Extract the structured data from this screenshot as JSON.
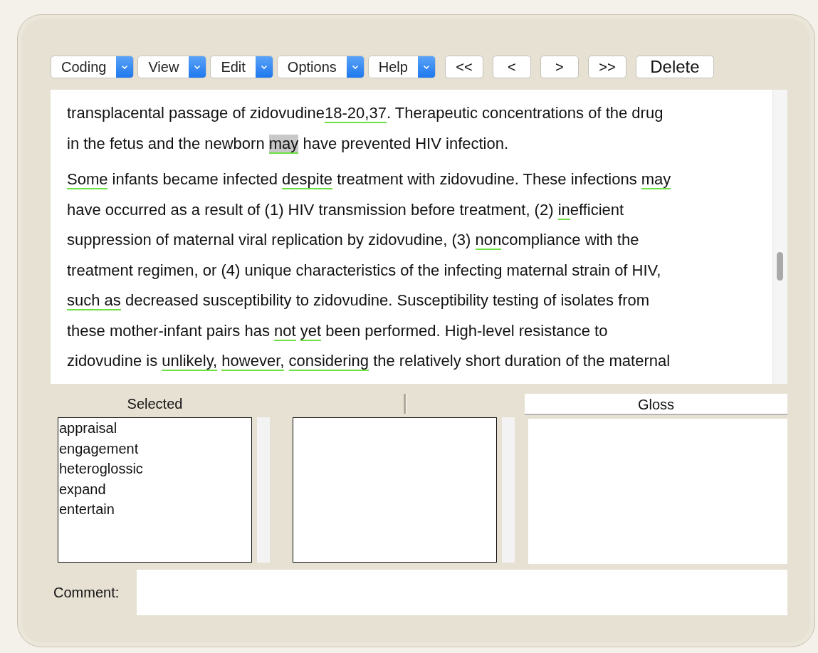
{
  "toolbar": [
    {
      "kind": "menu",
      "label": "Coding"
    },
    {
      "kind": "menu",
      "label": "View"
    },
    {
      "kind": "menu",
      "label": "Edit"
    },
    {
      "kind": "menu",
      "label": "Options"
    },
    {
      "kind": "menu",
      "label": "Help"
    },
    {
      "kind": "button",
      "label": "<<"
    },
    {
      "kind": "button",
      "label": "<"
    },
    {
      "kind": "button",
      "label": ">"
    },
    {
      "kind": "button",
      "label": ">>"
    },
    {
      "kind": "button",
      "label": "Delete"
    }
  ],
  "document": {
    "paragraphs": [
      [
        [
          {
            "text": "transplacental passage of zidovudine",
            "coded": false,
            "highlighted": false
          },
          {
            "text": "18-20,37",
            "coded": true,
            "highlighted": false
          },
          {
            "text": ". Therapeutic concentrations of the drug",
            "coded": false,
            "highlighted": false
          }
        ],
        [
          {
            "text": "in the fetus and the newborn ",
            "coded": false,
            "highlighted": false
          },
          {
            "text": "may",
            "coded": true,
            "highlighted": true
          },
          {
            "text": " have prevented HIV infection.",
            "coded": false,
            "highlighted": false
          }
        ]
      ],
      [
        [
          {
            "text": "Some",
            "coded": true,
            "highlighted": false
          },
          {
            "text": " infants became infected ",
            "coded": false,
            "highlighted": false
          },
          {
            "text": "despite",
            "coded": true,
            "highlighted": false
          },
          {
            "text": " treatment with zidovudine. These infections ",
            "coded": false,
            "highlighted": false
          },
          {
            "text": "may",
            "coded": true,
            "highlighted": false
          }
        ],
        [
          {
            "text": "have occurred as a result of (1) HIV transmission before treatment, (2) ",
            "coded": false,
            "highlighted": false
          },
          {
            "text": "in",
            "coded": true,
            "highlighted": false
          },
          {
            "text": "efficient",
            "coded": false,
            "highlighted": false
          }
        ],
        [
          {
            "text": "suppression of maternal viral replication by zidovudine, (3) ",
            "coded": false,
            "highlighted": false
          },
          {
            "text": "non",
            "coded": true,
            "highlighted": false
          },
          {
            "text": "compliance with the",
            "coded": false,
            "highlighted": false
          }
        ],
        [
          {
            "text": "treatment regimen, or (4) unique characteristics of the infecting maternal strain of HIV,",
            "coded": false,
            "highlighted": false
          }
        ],
        [
          {
            "text": "such as",
            "coded": true,
            "highlighted": false
          },
          {
            "text": " decreased susceptibility to zidovudine. Susceptibility testing of isolates from",
            "coded": false,
            "highlighted": false
          }
        ],
        [
          {
            "text": "these mother-infant pairs has ",
            "coded": false,
            "highlighted": false
          },
          {
            "text": "not",
            "coded": true,
            "highlighted": false
          },
          {
            "text": " yet",
            "coded": true,
            "highlighted": false
          },
          {
            "text": " been performed. High-level resistance to",
            "coded": false,
            "highlighted": false
          }
        ],
        [
          {
            "text": "zidovudine is ",
            "coded": false,
            "highlighted": false
          },
          {
            "text": "un",
            "coded": true,
            "highlighted": false
          },
          {
            "text": "likely,",
            "coded": true,
            "highlighted": false
          },
          {
            "text": " however,",
            "coded": true,
            "highlighted": false
          },
          {
            "text": " considering",
            "coded": true,
            "highlighted": false
          },
          {
            "text": " the relatively short duration of the maternal",
            "coded": false,
            "highlighted": false
          }
        ]
      ]
    ]
  },
  "selected": {
    "header": "Selected",
    "items": [
      "appraisal",
      "engagement",
      "heteroglossic",
      "expand",
      "entertain"
    ]
  },
  "gloss": {
    "header": "Gloss"
  },
  "comment": {
    "label": "Comment:"
  }
}
